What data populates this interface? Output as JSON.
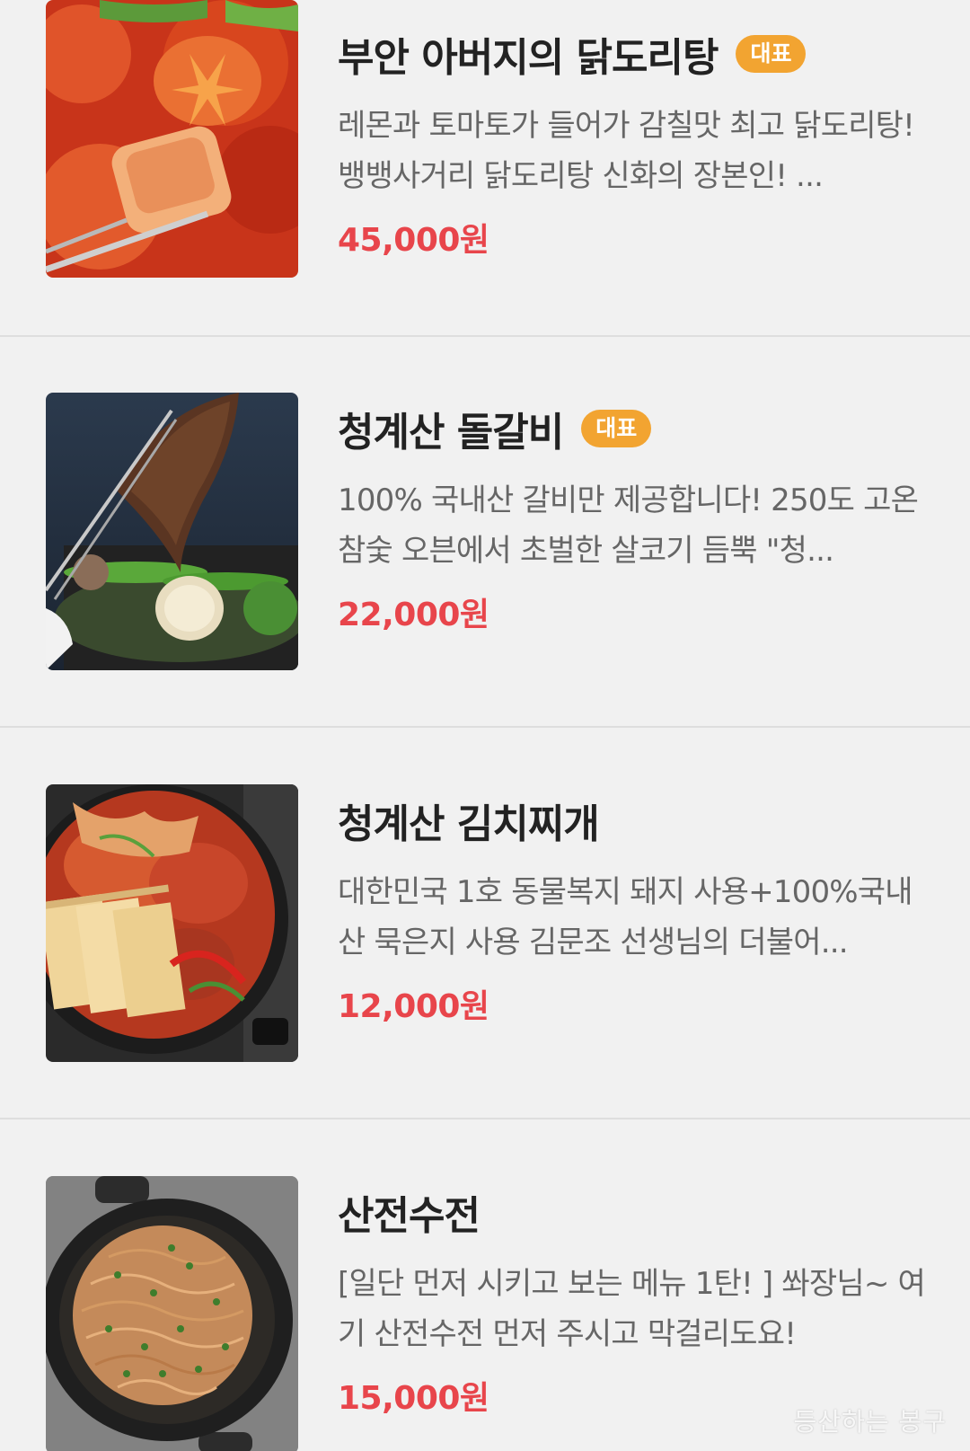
{
  "menu": {
    "items": [
      {
        "name": "부안 아버지의 닭도리탕",
        "badge": "대표",
        "description": "레몬과 토마토가 들어가 감칠맛 최고 닭도리탕! 뱅뱅사거리 닭도리탕 신화의 장본인! ...",
        "price": "45,000원",
        "image_icon": "spicy-chicken-stew-photo"
      },
      {
        "name": "청계산 돌갈비",
        "badge": "대표",
        "description": "100% 국내산 갈비만 제공합니다! 250도 고온 참숯 오븐에서 초벌한 살코기 듬뿍 \"청...",
        "price": "22,000원",
        "image_icon": "grilled-ribs-photo"
      },
      {
        "name": "청계산 김치찌개",
        "badge": "",
        "description": "대한민국 1호 동물복지 돼지 사용+100%국내산 묵은지 사용 김문조 선생님의 더불어...",
        "price": "12,000원",
        "image_icon": "kimchi-stew-photo"
      },
      {
        "name": "산전수전",
        "badge": "",
        "description": "[일단 먼저 시키고 보는 메뉴 1탄! ] 쏴장님~ 여기 산전수전 먼저 주시고 막걸리도요!",
        "price": "15,000원",
        "image_icon": "pancake-photo"
      }
    ]
  },
  "watermark": "등산하는 봉구",
  "colors": {
    "background": "#f1f1f1",
    "badge": "#f2a431",
    "price": "#e8454b"
  }
}
